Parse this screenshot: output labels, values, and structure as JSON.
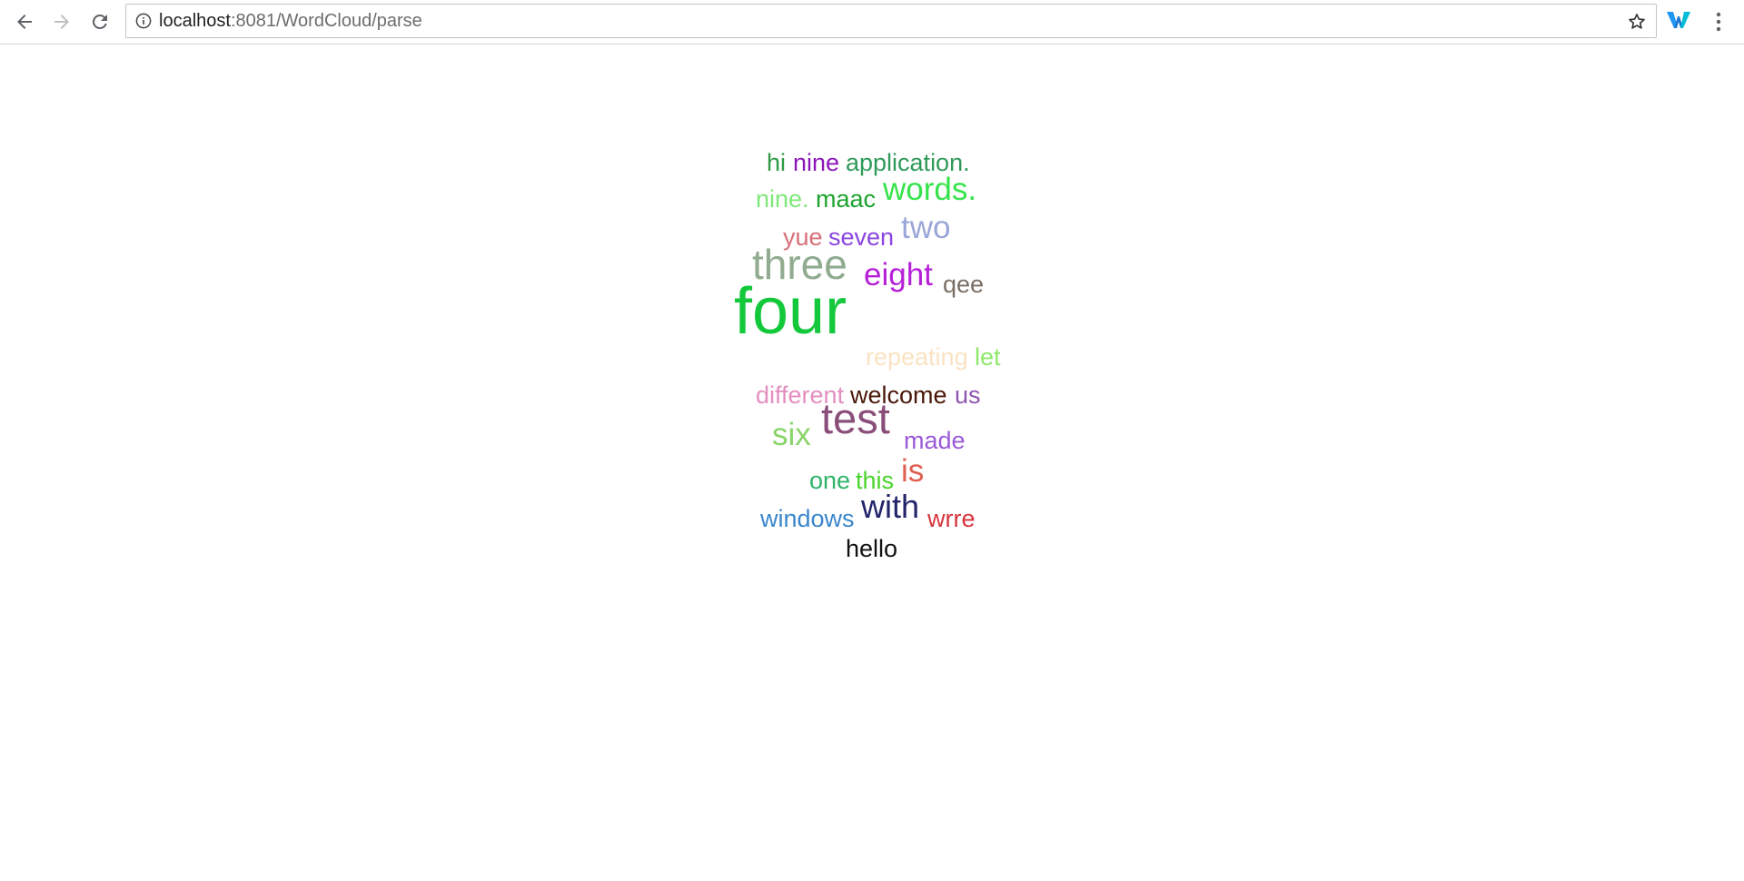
{
  "browser": {
    "url_host": "localhost",
    "url_rest": ":8081/WordCloud/parse"
  },
  "colors": {
    "toolbar_icon": "#5f6368",
    "toolbar_icon_disabled": "#c0c0c0",
    "extension_primary": "#2196f3",
    "extension_secondary": "#00bcd4"
  },
  "wordcloud": {
    "words": [
      {
        "text": "hi",
        "color": "#2e9a43"
      },
      {
        "text": "nine",
        "color": "#8a16b8"
      },
      {
        "text": "application.",
        "color": "#2f9a5a"
      },
      {
        "text": "nine.",
        "color": "#7fe87a"
      },
      {
        "text": "maac",
        "color": "#1ea32e"
      },
      {
        "text": "words.",
        "color": "#35e34a"
      },
      {
        "text": "yue",
        "color": "#d66f78"
      },
      {
        "text": "seven",
        "color": "#8a44e0"
      },
      {
        "text": "two",
        "color": "#9aa6d8"
      },
      {
        "text": "three",
        "color": "#90ab8f"
      },
      {
        "text": "eight",
        "color": "#b520d8"
      },
      {
        "text": "qee",
        "color": "#7a6e64"
      },
      {
        "text": "four",
        "color": "#14c83c"
      },
      {
        "text": "repeating",
        "color": "#fae3c2"
      },
      {
        "text": "let",
        "color": "#8ee86a"
      },
      {
        "text": "different",
        "color": "#e48ec0"
      },
      {
        "text": "welcome",
        "color": "#4a1808"
      },
      {
        "text": "us",
        "color": "#8e54b0"
      },
      {
        "text": "six",
        "color": "#8ad46a"
      },
      {
        "text": "test",
        "color": "#8a4e7a"
      },
      {
        "text": "made",
        "color": "#9a5ad8"
      },
      {
        "text": "one",
        "color": "#2eb46a"
      },
      {
        "text": "this",
        "color": "#48d42a"
      },
      {
        "text": "is",
        "color": "#e06050"
      },
      {
        "text": "windows",
        "color": "#3a86cc"
      },
      {
        "text": "with",
        "color": "#24246a"
      },
      {
        "text": "wrre",
        "color": "#d8343e"
      },
      {
        "text": "hello",
        "color": "#111111"
      }
    ]
  }
}
